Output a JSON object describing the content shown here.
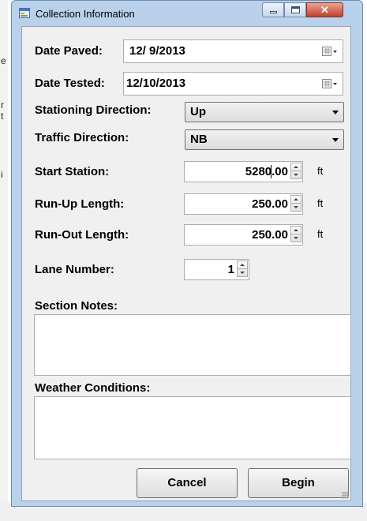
{
  "window": {
    "title": "Collection Information"
  },
  "fields": {
    "date_paved": {
      "label": "Date Paved:",
      "value": "12/  9/2013"
    },
    "date_tested": {
      "label": "Date Tested:",
      "value": "12/10/2013"
    },
    "stationing_direction": {
      "label": "Stationing Direction:",
      "value": "Up"
    },
    "traffic_direction": {
      "label": "Traffic Direction:",
      "value": "NB"
    },
    "start_station": {
      "label": "Start Station:",
      "value": "5280.00",
      "unit": "ft"
    },
    "run_up_length": {
      "label": "Run-Up Length:",
      "value": "250.00",
      "unit": "ft"
    },
    "run_out_length": {
      "label": "Run-Out Length:",
      "value": "250.00",
      "unit": "ft"
    },
    "lane_number": {
      "label": "Lane Number:",
      "value": "1"
    },
    "section_notes": {
      "label": "Section Notes:",
      "value": ""
    },
    "weather_conditions": {
      "label": "Weather Conditions:",
      "value": ""
    }
  },
  "buttons": {
    "cancel": "Cancel",
    "begin": "Begin"
  },
  "icons": {
    "app": "form-icon",
    "minimize": "minimize-icon",
    "maximize": "maximize-icon",
    "close": "close-icon",
    "calendar": "calendar-dropdown-icon",
    "combo": "chevron-down-icon",
    "spin": "spinner-arrows-icon"
  },
  "colors": {
    "frame": "#b9d1ea",
    "client": "#f0f0f0",
    "close": "#c0422a"
  }
}
